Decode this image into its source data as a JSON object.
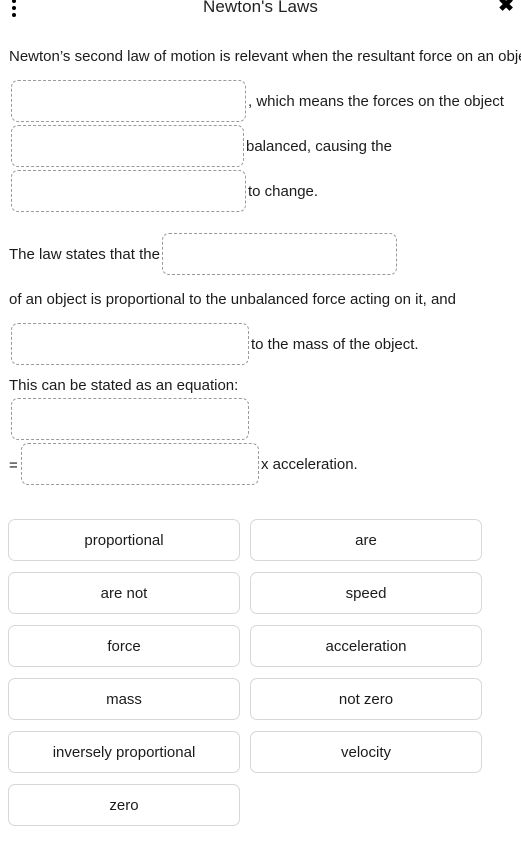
{
  "header": {
    "title": "Newton's Laws",
    "menu_icon": "more-vertical-icon",
    "close_icon": "✖"
  },
  "paragraph1": {
    "seg1": "Newton’s second law of motion is relevant when the resultant force on an object is",
    "seg2": ", which means the forces on the object",
    "seg3": "balanced, causing the",
    "seg4": "to change."
  },
  "paragraph2": {
    "seg1": "The law states that the",
    "seg2": "of an object is proportional to the unbalanced force acting on it, and",
    "seg3": "to the mass of the object."
  },
  "equation": {
    "prompt": "This can be stated as an equation:",
    "equals": "=",
    "times": "x  acceleration."
  },
  "wordbank": {
    "options": [
      {
        "label": "proportional"
      },
      {
        "label": "are"
      },
      {
        "label": "are not"
      },
      {
        "label": "speed"
      },
      {
        "label": "force"
      },
      {
        "label": "acceleration"
      },
      {
        "label": "mass"
      },
      {
        "label": "not zero"
      },
      {
        "label": "inversely proportional"
      },
      {
        "label": "velocity"
      },
      {
        "label": "zero"
      }
    ]
  },
  "blanks": [
    {
      "id": "blank-1",
      "value": ""
    },
    {
      "id": "blank-2",
      "value": ""
    },
    {
      "id": "blank-3",
      "value": ""
    },
    {
      "id": "blank-4",
      "value": ""
    },
    {
      "id": "blank-5",
      "value": ""
    },
    {
      "id": "blank-6",
      "value": ""
    },
    {
      "id": "blank-7",
      "value": ""
    }
  ],
  "colors": {
    "background": "#ffffff",
    "text": "#1b1b1b",
    "blank_border": "#9a9a9a",
    "chip_border": "#d8d8d8"
  }
}
